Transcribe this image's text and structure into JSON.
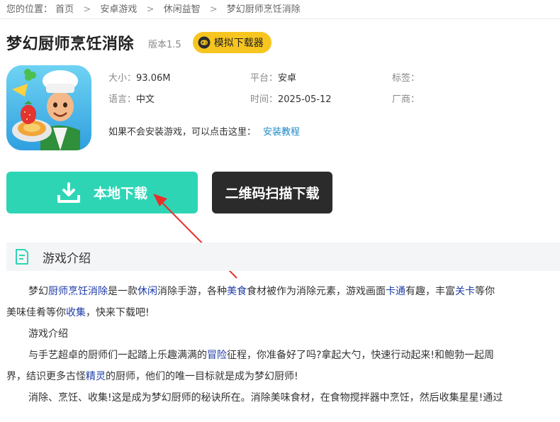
{
  "breadcrumb": {
    "prefix": "您的位置：",
    "items": [
      "首页",
      "安卓游戏",
      "休闲益智",
      "梦幻厨师烹饪消除"
    ],
    "separator": ">"
  },
  "game": {
    "title": "梦幻厨师烹饪消除",
    "version": "版本1.5",
    "emulator_button": "模拟下载器"
  },
  "info": {
    "size_label": "大小：",
    "size_value": "93.06M",
    "platform_label": "平台：",
    "platform_value": "安卓",
    "tags_label": "标签：",
    "tags_value": "",
    "language_label": "语言：",
    "language_value": "中文",
    "time_label": "时间：",
    "time_value": "2025-05-12",
    "vendor_label": "厂商：",
    "vendor_value": "",
    "install_hint": "如果不会安装游戏，可以点击这里：",
    "install_link": "安装教程"
  },
  "downloads": {
    "local_label": "本地下载",
    "qr_label": "二维码扫描下载"
  },
  "section": {
    "title": "游戏介绍"
  },
  "description": {
    "p1": {
      "t1": "梦幻",
      "l1": "厨师",
      "l2": "烹饪",
      "l3": "消除",
      "t2": "是一款",
      "l4": "休闲",
      "t3": "消除手游，各种",
      "l5": "美食",
      "t4": "食材被作为消除元素，游戏画面",
      "l6": "卡通",
      "t5": "有趣，丰富",
      "l7": "关卡",
      "t6": "等你"
    },
    "p1b": {
      "t1": "美味佳肴等你",
      "l1": "收集",
      "t2": "，快来下载吧!"
    },
    "subtitle": "游戏介绍",
    "p2": {
      "t1": "与手艺超卓的厨师们一起踏上乐趣满满的",
      "l1": "冒险",
      "t2": "征程，你准备好了吗?拿起大勺，快速行动起来!和鲍勃一起周"
    },
    "p2b": {
      "t1": "界，结识更多古怪",
      "l1": "精灵",
      "t2": "的厨师，他们的唯一目标就是成为梦幻厨师!"
    },
    "p3": "消除、烹饪、收集!这是成为梦幻厨师的秘诀所在。消除美味食材，在食物搅拌器中烹饪，然后收集星星!通过"
  },
  "colors": {
    "download_local": "#2ed5b5",
    "download_qr": "#2b2b2b",
    "emulator_button": "#f7c520",
    "link": "#1e3ca8",
    "arrow": "#e8302a"
  }
}
